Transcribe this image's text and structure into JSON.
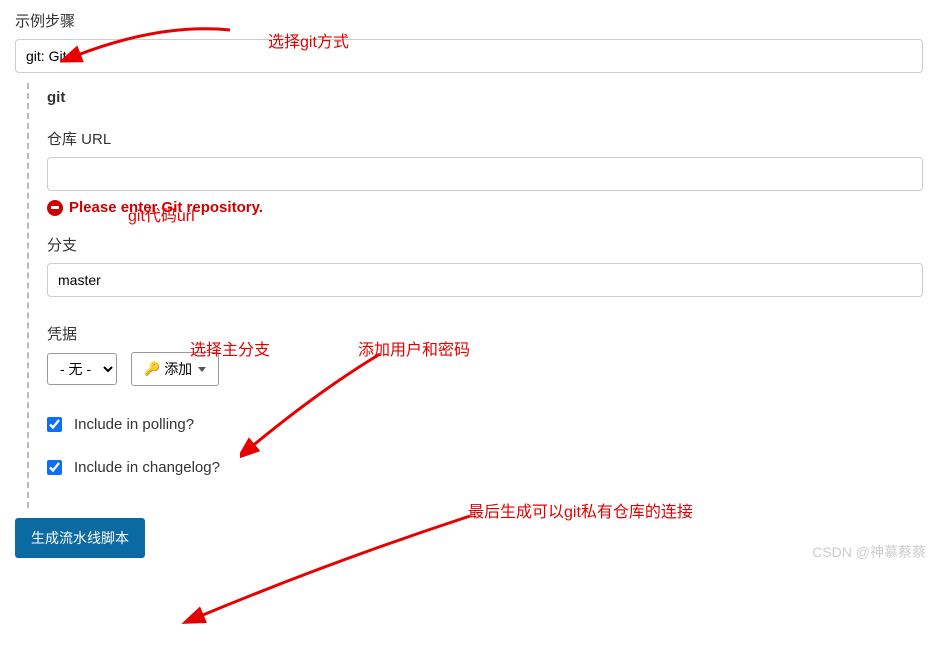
{
  "header": {
    "example_steps_label": "示例步骤"
  },
  "step": {
    "value": "git: Git"
  },
  "git": {
    "title": "git",
    "url_label": "仓库 URL",
    "url_value": "",
    "error_text": "Please enter Git repository.",
    "branch_label": "分支",
    "branch_value": "master",
    "creds_label": "凭据",
    "creds_select": "- 无 -",
    "add_button": "添加",
    "include_polling": "Include in polling?",
    "include_changelog": "Include in changelog?"
  },
  "generate_button": "生成流水线脚本",
  "annotations": {
    "choose_git": "选择git方式",
    "git_url": "git代码url",
    "choose_branch": "选择主分支",
    "add_user_pw": "添加用户和密码",
    "final_gen": "最后生成可以git私有仓库的连接"
  },
  "watermark": "CSDN @神慕蔡蔡"
}
